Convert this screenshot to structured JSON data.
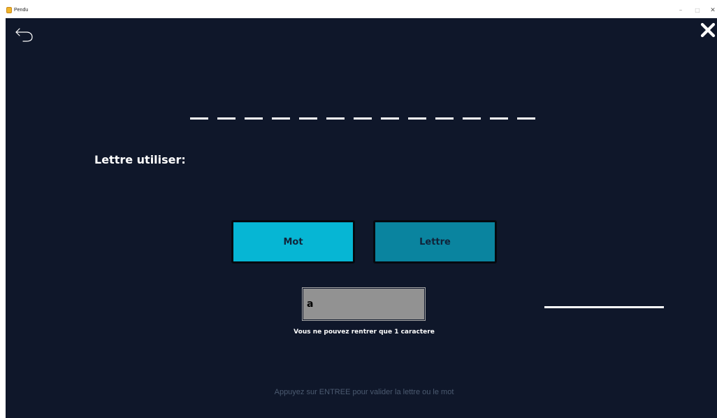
{
  "window": {
    "title": "Pendu",
    "app_icon": "app-icon",
    "controls": {
      "minimize": "–",
      "maximize": "□",
      "close": "✕"
    }
  },
  "game": {
    "background_color": "#0f172a",
    "back_icon": "back-arrow-icon",
    "close_icon": "close-icon",
    "word_mask_count": 13,
    "used_letters_label": "Lettre utiliser:",
    "buttons": {
      "word_label": "Mot",
      "letter_label": "Lettre",
      "word_color": "#06b6d4",
      "letter_color": "#0a849f"
    },
    "input": {
      "value": "a"
    },
    "validation_message": "Vous ne pouvez rentrer que 1 caractere",
    "footer_hint": "Appuyez sur ENTREE pour valider la lettre ou le mot"
  }
}
